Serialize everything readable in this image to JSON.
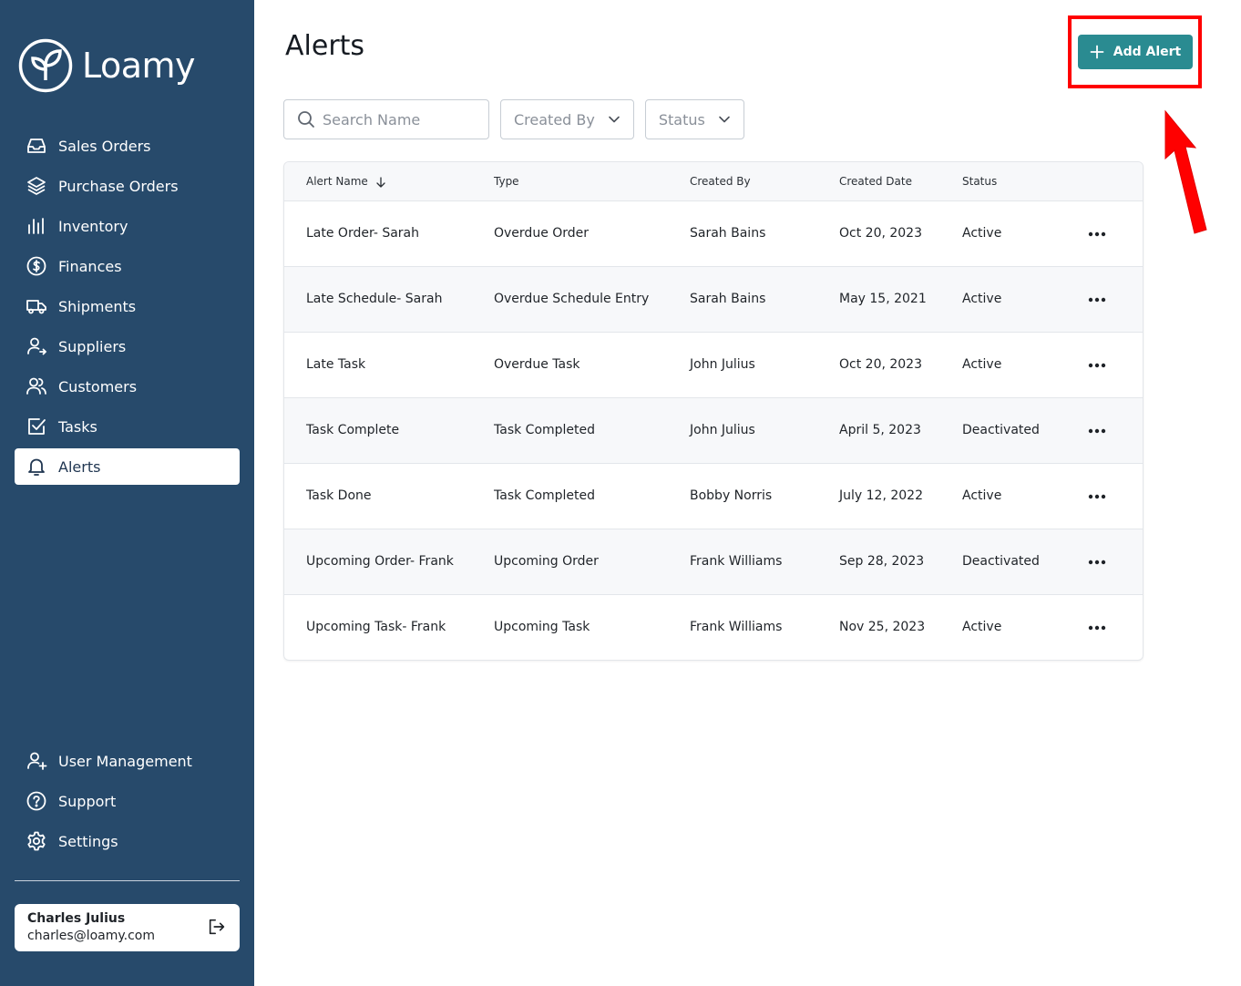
{
  "brand": {
    "name": "Loamy"
  },
  "sidebar": {
    "items": [
      {
        "label": "Sales Orders",
        "icon": "inbox-icon"
      },
      {
        "label": "Purchase Orders",
        "icon": "layers-icon"
      },
      {
        "label": "Inventory",
        "icon": "bar-chart-icon"
      },
      {
        "label": "Finances",
        "icon": "dollar-circle-icon"
      },
      {
        "label": "Shipments",
        "icon": "truck-icon"
      },
      {
        "label": "Suppliers",
        "icon": "user-arrow-icon"
      },
      {
        "label": "Customers",
        "icon": "users-icon"
      },
      {
        "label": "Tasks",
        "icon": "checkbox-icon"
      },
      {
        "label": "Alerts",
        "icon": "bell-icon",
        "active": true
      }
    ],
    "bottom_items": [
      {
        "label": "User Management",
        "icon": "user-plus-icon"
      },
      {
        "label": "Support",
        "icon": "help-circle-icon"
      },
      {
        "label": "Settings",
        "icon": "gear-icon"
      }
    ],
    "user": {
      "name": "Charles Julius",
      "email": "charles@loamy.com"
    }
  },
  "header": {
    "title": "Alerts",
    "add_button_label": "Add Alert"
  },
  "filters": {
    "search_placeholder": "Search Name",
    "created_by_label": "Created By",
    "status_label": "Status"
  },
  "table": {
    "columns": [
      "Alert Name",
      "Type",
      "Created By",
      "Created Date",
      "Status"
    ],
    "rows": [
      [
        "Late Order- Sarah",
        "Overdue Order",
        "Sarah Bains",
        "Oct 20, 2023",
        "Active"
      ],
      [
        "Late Schedule- Sarah",
        "Overdue Schedule Entry",
        "Sarah Bains",
        "May 15, 2021",
        "Active"
      ],
      [
        "Late Task",
        "Overdue Task",
        "John Julius",
        "Oct 20, 2023",
        "Active"
      ],
      [
        "Task Complete",
        "Task Completed",
        "John Julius",
        "April 5, 2023",
        "Deactivated"
      ],
      [
        "Task Done",
        "Task Completed",
        "Bobby Norris",
        "July 12, 2022",
        "Active"
      ],
      [
        "Upcoming Order- Frank",
        "Upcoming Order",
        "Frank Williams",
        "Sep 28, 2023",
        "Deactivated"
      ],
      [
        "Upcoming Task- Frank",
        "Upcoming Task",
        "Frank Williams",
        "Nov 25, 2023",
        "Active"
      ]
    ]
  },
  "colors": {
    "sidebar_bg": "#274a6b",
    "accent": "#2a8b91",
    "highlight": "#ff0000"
  }
}
